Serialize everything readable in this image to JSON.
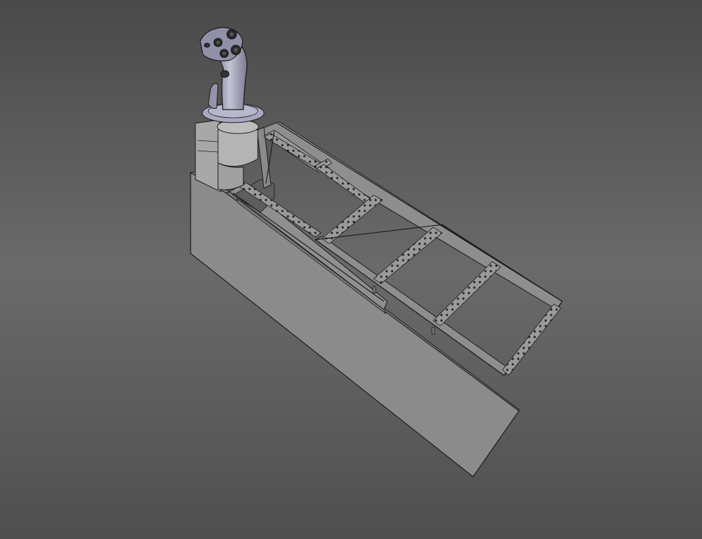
{
  "scene": {
    "background_top": "#4a4a4a",
    "background_mid": "#6a6a6a",
    "background_bottom": "#4f4f4f",
    "panel_fill": "#8c8c8c",
    "panel_side": "#7a7a7a",
    "frame_fill": "#909090",
    "edge_color": "#1a1a1a",
    "joystick_fill": "#9a9ab0",
    "joystick_dark": "#2a2a2a"
  }
}
